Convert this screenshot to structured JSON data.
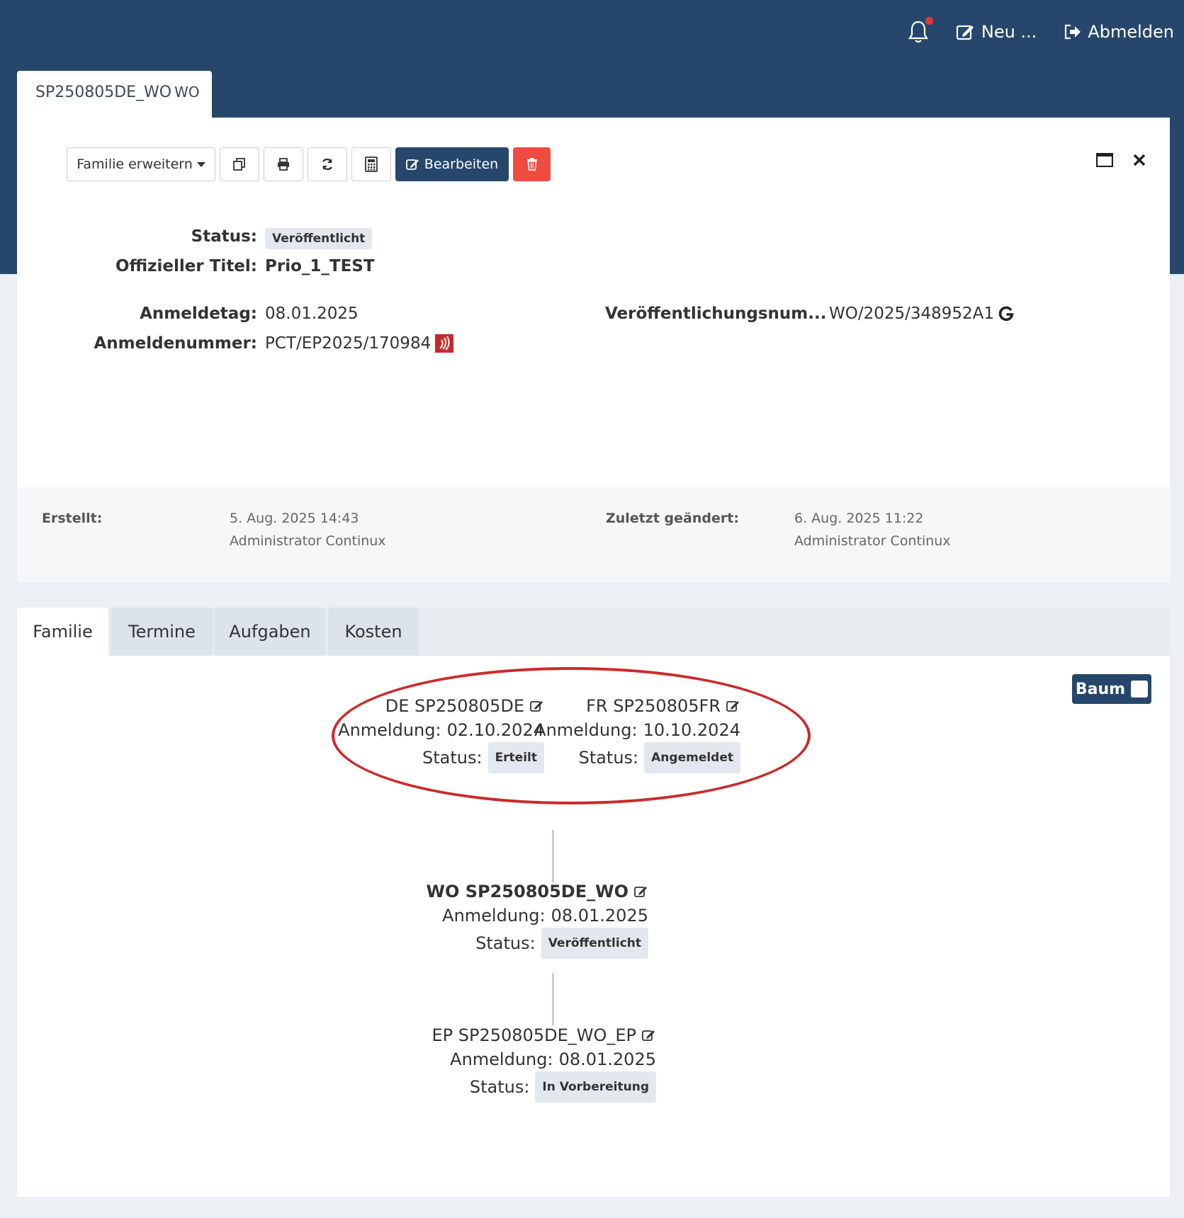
{
  "topnav": {
    "new_label": "Neu ...",
    "logout_label": "Abmelden"
  },
  "doctab": {
    "title": "SP250805DE_WO",
    "suffix": "WO"
  },
  "toolbar": {
    "extend_family_label": "Familie erweitern",
    "edit_label": "Bearbeiten"
  },
  "details": {
    "status_label": "Status:",
    "status_value": "Veröffentlicht",
    "official_title_label": "Offizieller Titel:",
    "official_title_value": "Prio_1_TEST",
    "filing_date_label": "Anmeldetag:",
    "filing_date_value": "08.01.2025",
    "application_number_label": "Anmeldenummer:",
    "application_number_value": "PCT/EP2025/170984",
    "publication_number_label": "Veröffentlichungsnum...",
    "publication_number_value": "WO/2025/348952A1"
  },
  "meta": {
    "created_label": "Erstellt:",
    "created_date": "5. Aug. 2025 14:43",
    "created_by": "Administrator Continux",
    "modified_label": "Zuletzt geändert:",
    "modified_date": "6. Aug. 2025 11:22",
    "modified_by": "Administrator Continux"
  },
  "tabs": [
    "Familie",
    "Termine",
    "Aufgaben",
    "Kosten"
  ],
  "baum_label": "Baum",
  "family": {
    "anmeldung_prefix": "Anmeldung:",
    "status_prefix": "Status:",
    "nodes": [
      {
        "title": "DE SP250805DE",
        "date": "02.10.2024",
        "status": "Erteilt"
      },
      {
        "title": "FR SP250805FR",
        "date": "10.10.2024",
        "status": "Angemeldet"
      },
      {
        "title": "WO SP250805DE_WO",
        "date": "08.01.2025",
        "status": "Veröffentlicht"
      },
      {
        "title": "EP SP250805DE_WO_EP",
        "date": "08.01.2025",
        "status": "In Vorbereitung"
      }
    ]
  },
  "colors": {
    "header_bg": "#26476b",
    "primary": "#26476b",
    "danger": "#ee4b41",
    "highlight_ellipse": "#cc2a2a",
    "notification_dot": "#e53935"
  }
}
